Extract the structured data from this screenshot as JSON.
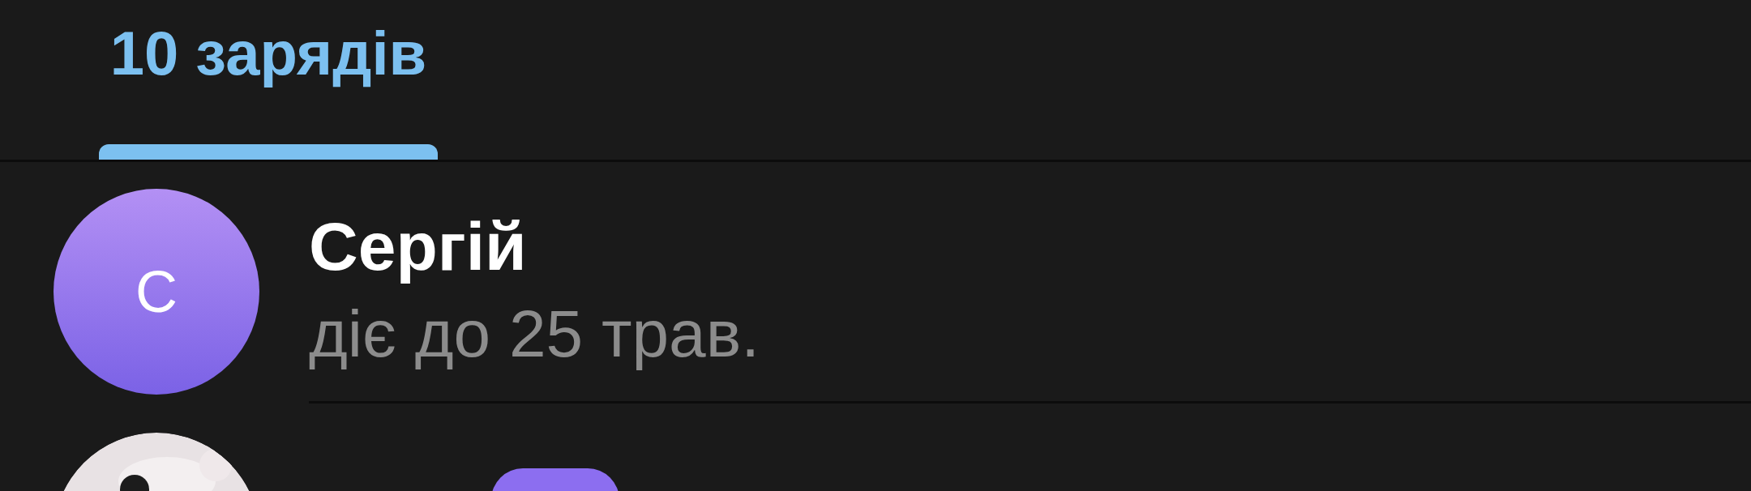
{
  "tabs": [
    {
      "label": "10 зарядів",
      "selected": true
    }
  ],
  "contacts": [
    {
      "kind": "letter",
      "avatar": "С",
      "name": "Сергій",
      "status": "діє до 25 трав."
    },
    {
      "kind": "picture",
      "badge": true
    }
  ]
}
